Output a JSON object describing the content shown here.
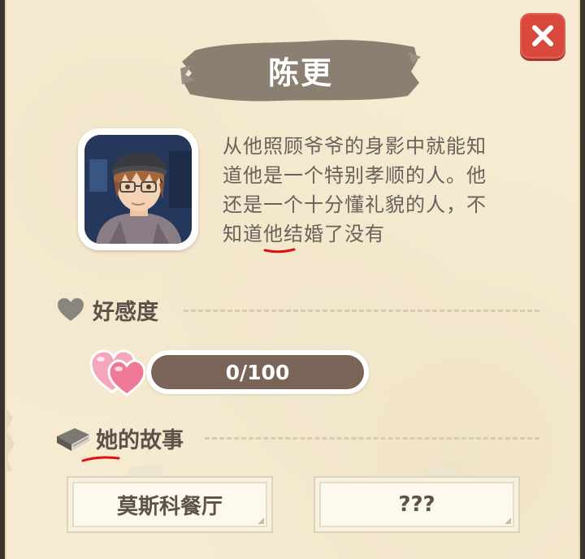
{
  "character": {
    "name": "陈更",
    "bio_lines": [
      "从他照顾爷爷的身影中就能知",
      "道他是一个特别孝顺的人。他",
      "还是一个十分懂礼貌的人，不",
      "知道他结婚了没有"
    ]
  },
  "affection": {
    "label": "好感度",
    "value": 0,
    "max": 100,
    "display": "0/100"
  },
  "story": {
    "label": "她的故事",
    "buttons": [
      {
        "label": "莫斯科餐厅"
      },
      {
        "label": "???"
      }
    ]
  },
  "icons": {
    "close": "close-icon",
    "heart": "heart-icon",
    "book": "book-icon",
    "hearts": "hearts-icon"
  },
  "colors": {
    "panel_bg": "#f7ecd3",
    "close_red": "#d9493b",
    "bar_brown": "#7a6457",
    "banner_brown": "#8b7f72",
    "text_brown": "#5d5149",
    "annotation_red": "#e01010"
  }
}
